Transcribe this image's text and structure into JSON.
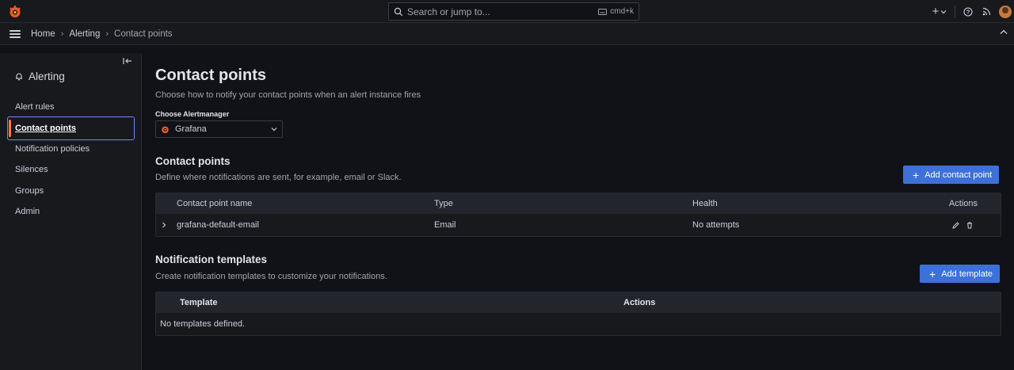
{
  "topbar": {
    "search_placeholder": "Search or jump to...",
    "search_shortcut": "cmd+k",
    "new_label": "+"
  },
  "breadcrumb": {
    "items": [
      "Home",
      "Alerting",
      "Contact points"
    ]
  },
  "sidebar": {
    "title": "Alerting",
    "items": [
      {
        "label": "Alert rules",
        "active": false
      },
      {
        "label": "Contact points",
        "active": true
      },
      {
        "label": "Notification policies",
        "active": false
      },
      {
        "label": "Silences",
        "active": false
      },
      {
        "label": "Groups",
        "active": false
      },
      {
        "label": "Admin",
        "active": false
      }
    ]
  },
  "main": {
    "title": "Contact points",
    "subtitle": "Choose how to notify your contact points when an alert instance fires",
    "alertmanager_label": "Choose Alertmanager",
    "alertmanager_value": "Grafana",
    "contact_points": {
      "title": "Contact points",
      "subtitle": "Define where notifications are sent, for example, email or Slack.",
      "add_button": "Add contact point",
      "columns": [
        "Contact point name",
        "Type",
        "Health",
        "Actions"
      ],
      "rows": [
        {
          "name": "grafana-default-email",
          "type": "Email",
          "health": "No attempts"
        }
      ]
    },
    "templates": {
      "title": "Notification templates",
      "subtitle": "Create notification templates to customize your notifications.",
      "add_button": "Add template",
      "columns": [
        "Template",
        "Actions"
      ],
      "empty_text": "No templates defined."
    }
  },
  "colors": {
    "background": "#111217",
    "panel": "#18191d",
    "primary": "#3d71d9",
    "active_border": "#6e8bff",
    "active_indicator": "#ff7a3d",
    "logo": "#f05a28"
  }
}
